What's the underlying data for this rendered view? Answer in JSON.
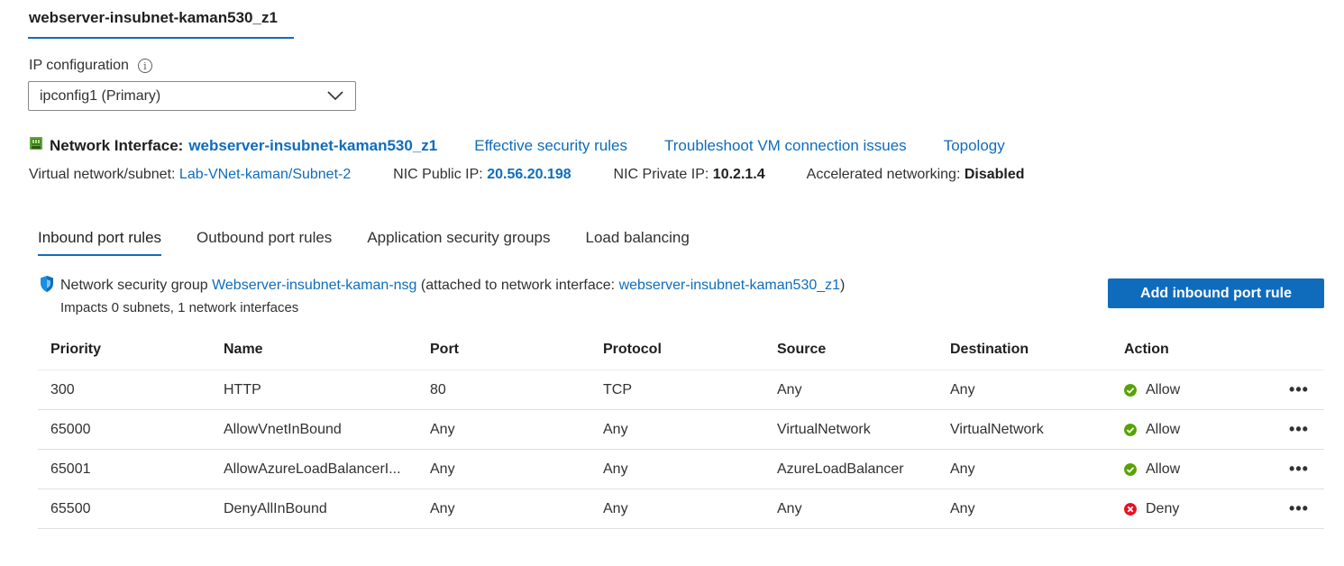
{
  "nic_tab": {
    "label": "webserver-insubnet-kaman530_z1"
  },
  "ip_config": {
    "label": "IP configuration",
    "info_glyph": "i",
    "selected": "ipconfig1 (Primary)"
  },
  "nic": {
    "label": "Network Interface:",
    "name": "webserver-insubnet-kaman530_z1",
    "links": [
      "Effective security rules",
      "Troubleshoot VM connection issues",
      "Topology"
    ]
  },
  "meta": {
    "vnet_label": "Virtual network/subnet:",
    "vnet_value": "Lab-VNet-kaman/Subnet-2",
    "public_ip_label": "NIC Public IP:",
    "public_ip_value": "20.56.20.198",
    "private_ip_label": "NIC Private IP:",
    "private_ip_value": "10.2.1.4",
    "accel_label": "Accelerated networking:",
    "accel_value": "Disabled"
  },
  "tabs": [
    {
      "label": "Inbound port rules",
      "active": true
    },
    {
      "label": "Outbound port rules",
      "active": false
    },
    {
      "label": "Application security groups",
      "active": false
    },
    {
      "label": "Load balancing",
      "active": false
    }
  ],
  "nsg": {
    "prefix": "Network security group",
    "name": "Webserver-insubnet-kaman-nsg",
    "middle": "(attached to network interface:",
    "nic_name": "webserver-insubnet-kaman530_z1",
    "suffix": ")",
    "impacts": "Impacts 0 subnets, 1 network interfaces"
  },
  "add_button": {
    "label": "Add inbound port rule"
  },
  "table": {
    "headers": [
      "Priority",
      "Name",
      "Port",
      "Protocol",
      "Source",
      "Destination",
      "Action"
    ],
    "rows": [
      {
        "priority": "300",
        "name": "HTTP",
        "port": "80",
        "protocol": "TCP",
        "source": "Any",
        "destination": "Any",
        "action": "Allow",
        "status": "allow"
      },
      {
        "priority": "65000",
        "name": "AllowVnetInBound",
        "port": "Any",
        "protocol": "Any",
        "source": "VirtualNetwork",
        "destination": "VirtualNetwork",
        "action": "Allow",
        "status": "allow"
      },
      {
        "priority": "65001",
        "name": "AllowAzureLoadBalancerI...",
        "port": "Any",
        "protocol": "Any",
        "source": "AzureLoadBalancer",
        "destination": "Any",
        "action": "Allow",
        "status": "allow"
      },
      {
        "priority": "65500",
        "name": "DenyAllInBound",
        "port": "Any",
        "protocol": "Any",
        "source": "Any",
        "destination": "Any",
        "action": "Deny",
        "status": "deny"
      }
    ],
    "more_glyph": "•••"
  },
  "colors": {
    "accent": "#0f6cbd",
    "allow": "#57a300",
    "deny": "#e81123"
  },
  "icons": {
    "nic": "network-interface-icon",
    "shield": "shield-icon",
    "info": "info-icon",
    "chevron": "chevron-down-icon",
    "allow": "check-circle-icon",
    "deny": "error-circle-icon",
    "more": "more-icon"
  }
}
